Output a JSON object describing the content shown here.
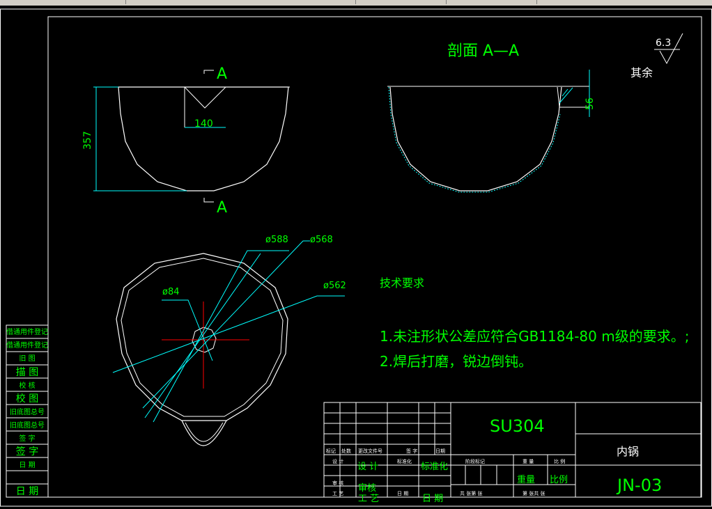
{
  "section_title": "剖面 A—A",
  "roughness": {
    "value": "6.3",
    "label": "其余"
  },
  "section_marks": {
    "top": "A",
    "bottom": "A"
  },
  "dims": {
    "height": "357",
    "spout_width": "140",
    "rim_height": "56",
    "d588": "ø588",
    "d568": "ø568",
    "d562": "ø562",
    "d84": "ø84"
  },
  "tech": {
    "title": "技术要求",
    "item1": "1.未注形状公差应符合GB1184-80 m级的要求。;",
    "item2": "2.焊后打磨，锐边倒钝。"
  },
  "side_strip": [
    "借通用件登记",
    "借通用件登记",
    "旧 图",
    "描 图",
    "校 核",
    "校 图",
    "旧底图总号",
    "旧底图总号",
    "签 字",
    "签 字",
    "日 期",
    "日 期"
  ],
  "title_block": {
    "material": "SU304",
    "part_name": "内锅",
    "drawing_no": "JN-03",
    "r_mark": "标记",
    "r_count": "处数",
    "r_doc": "更改文件号",
    "r_sign": "签 字",
    "r_date": "日期",
    "design": "设 计",
    "std_pen": "标准化",
    "std": "标准化",
    "review": "审 核",
    "check": "审核",
    "process": "工 艺",
    "craft": "工 艺",
    "date": "日 期",
    "date2": "日 期",
    "stage_mark": "阶段标记",
    "weight": "重 量",
    "scale": "比 例",
    "weight2": "重量",
    "scale2": "比例",
    "sheets": "共 张第 张",
    "sheets2": "第 张共 张"
  }
}
